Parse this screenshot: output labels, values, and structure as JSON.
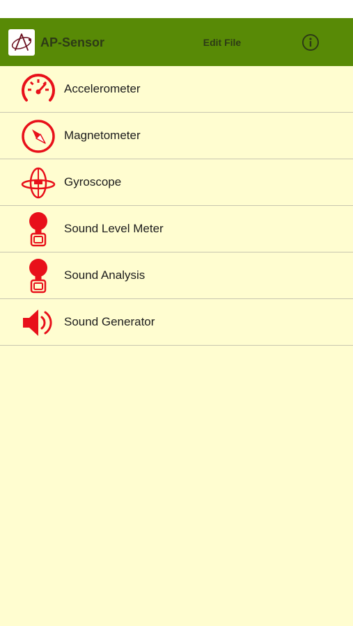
{
  "colors": {
    "nav_bar": "#588a06",
    "nav_text": "#2d3a16",
    "content_background": "#fffdd0",
    "icon_red": "#e8101a",
    "divider": "#c8c6b0"
  },
  "header": {
    "title": "AP-Sensor",
    "edit_label": "Edit File",
    "logo_icon": "atom-logo-icon",
    "info_icon": "info-icon"
  },
  "sensors": [
    {
      "label": "Accelerometer",
      "icon": "speedometer-icon"
    },
    {
      "label": "Magnetometer",
      "icon": "compass-icon"
    },
    {
      "label": "Gyroscope",
      "icon": "gyroscope-icon"
    },
    {
      "label": "Sound Level Meter",
      "icon": "microphone-icon"
    },
    {
      "label": "Sound Analysis",
      "icon": "microphone-icon"
    },
    {
      "label": "Sound Generator",
      "icon": "speaker-icon"
    }
  ]
}
